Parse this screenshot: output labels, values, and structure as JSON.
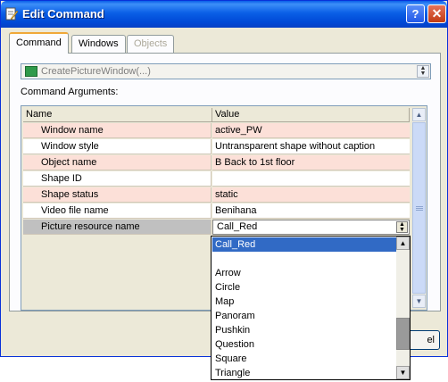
{
  "window": {
    "title": "Edit Command",
    "help_label": "?",
    "close_label": "✕"
  },
  "tabs": [
    {
      "label": "Command",
      "active": true
    },
    {
      "label": "Windows",
      "active": false
    },
    {
      "label": "Objects",
      "active": false,
      "disabled": true
    }
  ],
  "command": {
    "selected": "CreatePictureWindow(...)",
    "icon": "picture-window-icon"
  },
  "arguments": {
    "label": "Command Arguments:",
    "headers": [
      "Name",
      "Value"
    ],
    "rows": [
      {
        "name": "Window name",
        "value": "active_PW"
      },
      {
        "name": "Window style",
        "value": "Untransparent shape without caption"
      },
      {
        "name": "Object name",
        "value": "B Back to 1st floor"
      },
      {
        "name": "Shape ID",
        "value": ""
      },
      {
        "name": "Shape status",
        "value": "static"
      },
      {
        "name": "Video file name",
        "value": "Benihana"
      },
      {
        "name": "Picture resource name",
        "value": "Call_Red"
      }
    ]
  },
  "dropdown": {
    "options": [
      "Call_Red",
      "",
      "Arrow",
      "Circle",
      "Map",
      "Panoram",
      "Pushkin",
      "Question",
      "Square",
      "Triangle"
    ],
    "highlighted": "Call_Red"
  },
  "buttons": {
    "partial_label": "el"
  },
  "colors": {
    "title_bar": "#0a5fe6",
    "row_alt": "#fce0d8",
    "highlight": "#316ac5",
    "dialog_bg": "#ece9d8"
  }
}
